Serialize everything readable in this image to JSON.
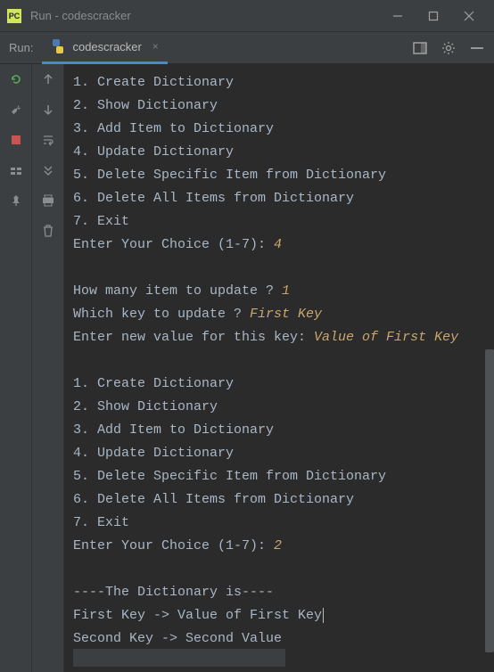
{
  "window": {
    "title": "Run - codescracker",
    "app_icon_text": "PC"
  },
  "toolbar": {
    "run_label": "Run:",
    "tab_name": "codescracker",
    "tab_close": "×"
  },
  "menu1": {
    "l1": "1. Create Dictionary",
    "l2": "2. Show Dictionary",
    "l3": "3. Add Item to Dictionary",
    "l4": "4. Update Dictionary",
    "l5": "5. Delete Specific Item from Dictionary",
    "l6": "6. Delete All Items from Dictionary",
    "l7": "7. Exit",
    "prompt": "Enter Your Choice (1-7): ",
    "choice": "4"
  },
  "update": {
    "q1": "How many item to update ? ",
    "a1": "1",
    "q2": "Which key to update ? ",
    "a2": "First Key",
    "q3": "Enter new value for this key: ",
    "a3": "Value of First Key"
  },
  "menu2": {
    "l1": "1. Create Dictionary",
    "l2": "2. Show Dictionary",
    "l3": "3. Add Item to Dictionary",
    "l4": "4. Update Dictionary",
    "l5": "5. Delete Specific Item from Dictionary",
    "l6": "6. Delete All Items from Dictionary",
    "l7": "7. Exit",
    "prompt": "Enter Your Choice (1-7): ",
    "choice": "2"
  },
  "output": {
    "header": "----The Dictionary is----",
    "row1": "First Key -> Value of First Key",
    "row2": "Second Key -> Second Value"
  }
}
